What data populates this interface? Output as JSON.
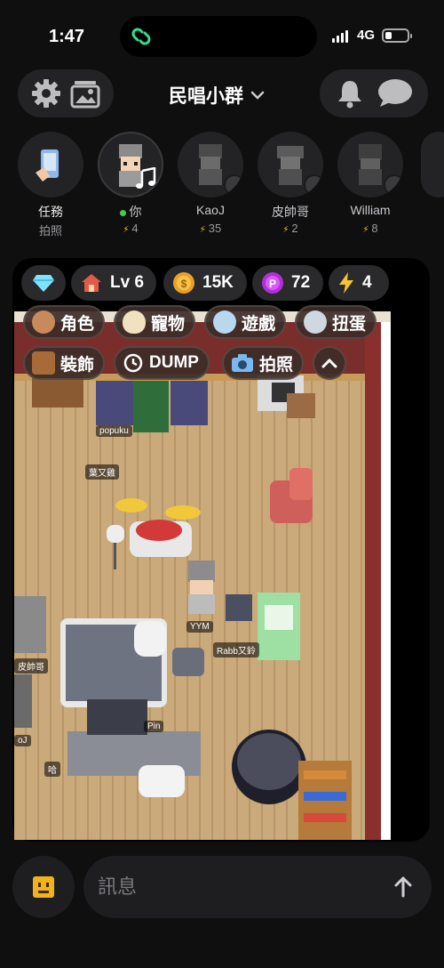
{
  "status_bar": {
    "time": "1:47",
    "network": "4G"
  },
  "header": {
    "group_name": "民唱小群"
  },
  "task": {
    "title": "任務",
    "subtitle": "拍照"
  },
  "members": [
    {
      "name": "你",
      "energy": "4",
      "online": true
    },
    {
      "name": "KaoJ",
      "energy": "35"
    },
    {
      "name": "皮帥哥",
      "energy": "2"
    },
    {
      "name": "William",
      "energy": "8"
    }
  ],
  "hud": {
    "level": "Lv 6",
    "coins": "15K",
    "points": "72",
    "energy": "4"
  },
  "menu": {
    "character": "角色",
    "pet": "寵物",
    "games": "遊戲",
    "gacha": "扭蛋",
    "decor": "裝飾",
    "dump": "DUMP",
    "photo": "拍照"
  },
  "scene_labels": {
    "popuku": "popuku",
    "ye": "葉又雞",
    "yym": "YYM",
    "rabb": "Rabb又鈴",
    "pi": "皮帥哥",
    "oj": "oJ",
    "ha": "哈",
    "pin": "Pin"
  },
  "composer": {
    "placeholder": "訊息"
  }
}
